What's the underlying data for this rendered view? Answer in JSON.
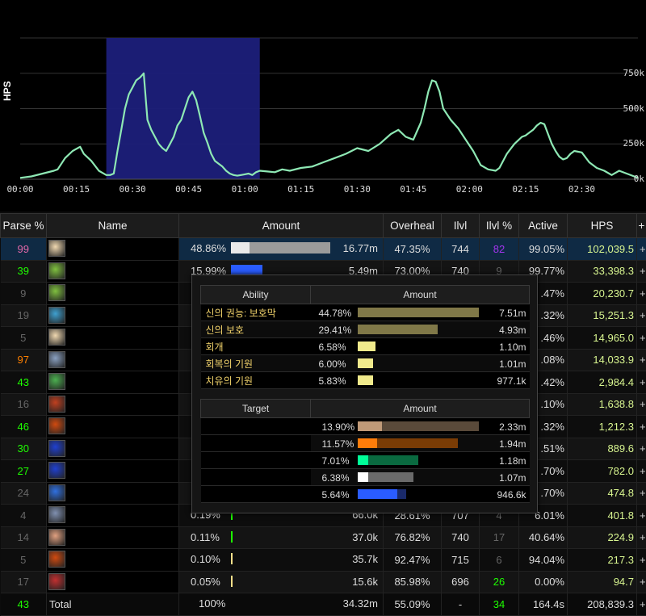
{
  "chart_data": {
    "type": "area",
    "ylabel": "HPS",
    "y_ticks": [
      "750k",
      "500k",
      "250k",
      "0k"
    ],
    "y_tick_values": [
      750000,
      500000,
      250000,
      0
    ],
    "x_ticks": [
      "00:00",
      "00:15",
      "00:30",
      "00:45",
      "01:00",
      "01:15",
      "01:30",
      "01:45",
      "02:00",
      "02:15",
      "02:30"
    ],
    "ylim": [
      0,
      1000000
    ],
    "xlim_seconds": [
      0,
      165
    ],
    "selection_seconds": [
      23,
      64
    ],
    "line_color": "#8ee8b4",
    "selection_color": "#1c1f7a",
    "series": [
      {
        "x": [
          0,
          3,
          6,
          9,
          10,
          12,
          14,
          16,
          17,
          19,
          21,
          23,
          24,
          25,
          26,
          27,
          28,
          29,
          30,
          31,
          32,
          33,
          34,
          35,
          36,
          37,
          38,
          39,
          40,
          41,
          42,
          43,
          44,
          45,
          46,
          47,
          48,
          49,
          50,
          51,
          52,
          53,
          54,
          55,
          56,
          57,
          58,
          59,
          60,
          61,
          62,
          63,
          64,
          66,
          68,
          70,
          72,
          75,
          78,
          81,
          84,
          87,
          90,
          93,
          96,
          99,
          101,
          103,
          105,
          107,
          108,
          109,
          110,
          111,
          112,
          113,
          115,
          117,
          119,
          121,
          123,
          125,
          127,
          128,
          130,
          132,
          134,
          135,
          136,
          137,
          138,
          139,
          140,
          141,
          142,
          143,
          144,
          145,
          146,
          147,
          148,
          150,
          152,
          154,
          156,
          158,
          160,
          162,
          164,
          165
        ],
        "y": [
          10000,
          20000,
          40000,
          60000,
          70000,
          150000,
          200000,
          230000,
          180000,
          130000,
          60000,
          30000,
          30000,
          40000,
          200000,
          350000,
          500000,
          600000,
          650000,
          700000,
          720000,
          750000,
          420000,
          350000,
          300000,
          250000,
          220000,
          200000,
          250000,
          300000,
          380000,
          420000,
          500000,
          580000,
          620000,
          560000,
          450000,
          330000,
          260000,
          180000,
          130000,
          110000,
          90000,
          60000,
          40000,
          30000,
          25000,
          30000,
          35000,
          40000,
          30000,
          50000,
          60000,
          55000,
          50000,
          70000,
          60000,
          80000,
          90000,
          120000,
          150000,
          180000,
          220000,
          200000,
          250000,
          320000,
          350000,
          300000,
          280000,
          400000,
          500000,
          620000,
          700000,
          690000,
          620000,
          500000,
          420000,
          360000,
          280000,
          200000,
          100000,
          70000,
          60000,
          80000,
          180000,
          250000,
          300000,
          310000,
          330000,
          350000,
          380000,
          400000,
          390000,
          320000,
          250000,
          200000,
          160000,
          140000,
          150000,
          180000,
          200000,
          190000,
          120000,
          80000,
          60000,
          30000,
          60000,
          40000,
          20000,
          10000
        ]
      }
    ]
  },
  "columns": [
    "Parse %",
    "Name",
    "Amount",
    "Overheal",
    "Ilvl",
    "Ilvl %",
    "Active",
    "HPS",
    "+"
  ],
  "players": [
    {
      "parse": "99",
      "parse_color": "#e268a8",
      "amount_pct": "48.86%",
      "amount": "16.77m",
      "bar1": 0.184,
      "bar1_color": "#e9e9e9",
      "bar2": 0.816,
      "bar2_color": "#9b9b9b",
      "overheal": "47.35%",
      "ilvl": "744",
      "ilvl_pct": "82",
      "ilvl_pct_color": "#a335ee",
      "active": "99.05%",
      "hps": "102,039.5",
      "icon": "holy-priest-icon",
      "icon_color": "#f0d8b0"
    },
    {
      "parse": "39",
      "parse_color": "#1eff00",
      "amount_pct": "15.99%",
      "amount": "5.49m",
      "bar1": 0.32,
      "bar1_color": "#2a5cff",
      "bar2": 0,
      "bar2_color": "#1a2a6a",
      "overheal": "73.00%",
      "ilvl": "740",
      "ilvl_pct": "9",
      "ilvl_pct_color": "#666666",
      "active": "99.77%",
      "hps": "33,398.3",
      "icon": "resto-druid-icon",
      "icon_color": "#7fbf3f"
    },
    {
      "parse": "9",
      "parse_color": "#666666",
      "amount_pct": "",
      "amount": "",
      "bar1": 0,
      "bar1_color": "#ffffff",
      "bar2": 0,
      "bar2_color": "#000000",
      "overheal": "",
      "ilvl": "",
      "ilvl_pct": "",
      "ilvl_pct_color": "#666666",
      "active": ".47%",
      "hps": "20,230.7",
      "icon": "resto-druid-icon",
      "icon_color": "#7fbf3f"
    },
    {
      "parse": "19",
      "parse_color": "#666666",
      "amount_pct": "",
      "amount": "",
      "bar1": 0,
      "bar1_color": "#ffffff",
      "bar2": 0,
      "bar2_color": "#000000",
      "overheal": "",
      "ilvl": "",
      "ilvl_pct": "",
      "ilvl_pct_color": "#666666",
      "active": ".32%",
      "hps": "15,251.3",
      "icon": "mistweaver-icon",
      "icon_color": "#3fa0d0"
    },
    {
      "parse": "5",
      "parse_color": "#666666",
      "amount_pct": "",
      "amount": "",
      "bar1": 0,
      "bar1_color": "#ffffff",
      "bar2": 0,
      "bar2_color": "#000000",
      "overheal": "",
      "ilvl": "",
      "ilvl_pct": "",
      "ilvl_pct_color": "#666666",
      "active": ".46%",
      "hps": "14,965.0",
      "icon": "holy-priest-icon",
      "icon_color": "#f0d8b0"
    },
    {
      "parse": "97",
      "parse_color": "#ff8000",
      "amount_pct": "",
      "amount": "",
      "bar1": 0,
      "bar1_color": "#ffffff",
      "bar2": 0,
      "bar2_color": "#000000",
      "overheal": "",
      "ilvl": "",
      "ilvl_pct": "",
      "ilvl_pct_color": "#666666",
      "active": ".08%",
      "hps": "14,033.9",
      "icon": "protection-warrior-icon",
      "icon_color": "#8aa0c0"
    },
    {
      "parse": "43",
      "parse_color": "#1eff00",
      "amount_pct": "",
      "amount": "",
      "bar1": 0,
      "bar1_color": "#ffffff",
      "bar2": 0,
      "bar2_color": "#000000",
      "overheal": "",
      "ilvl": "",
      "ilvl_pct": "",
      "ilvl_pct_color": "#666666",
      "active": ".42%",
      "hps": "2,984.4",
      "icon": "guardian-druid-icon",
      "icon_color": "#4caf50"
    },
    {
      "parse": "16",
      "parse_color": "#666666",
      "amount_pct": "",
      "amount": "",
      "bar1": 0,
      "bar1_color": "#ffffff",
      "bar2": 0,
      "bar2_color": "#000000",
      "overheal": "",
      "ilvl": "",
      "ilvl_pct": "",
      "ilvl_pct_color": "#666666",
      "active": ".10%",
      "hps": "1,638.8",
      "icon": "fury-warrior-icon",
      "icon_color": "#c04020"
    },
    {
      "parse": "46",
      "parse_color": "#1eff00",
      "amount_pct": "",
      "amount": "",
      "bar1": 0,
      "bar1_color": "#ffffff",
      "bar2": 0,
      "bar2_color": "#000000",
      "overheal": "",
      "ilvl": "",
      "ilvl_pct": "",
      "ilvl_pct_color": "#666666",
      "active": ".32%",
      "hps": "1,212.3",
      "icon": "retribution-paladin-icon",
      "icon_color": "#d04a10"
    },
    {
      "parse": "30",
      "parse_color": "#1eff00",
      "amount_pct": "",
      "amount": "",
      "bar1": 0,
      "bar1_color": "#ffffff",
      "bar2": 0,
      "bar2_color": "#000000",
      "overheal": "",
      "ilvl": "",
      "ilvl_pct": "",
      "ilvl_pct_color": "#666666",
      "active": ".51%",
      "hps": "889.6",
      "icon": "elemental-shaman-icon",
      "icon_color": "#2040d0"
    },
    {
      "parse": "27",
      "parse_color": "#1eff00",
      "amount_pct": "",
      "amount": "",
      "bar1": 0,
      "bar1_color": "#ffffff",
      "bar2": 0,
      "bar2_color": "#000000",
      "overheal": "",
      "ilvl": "",
      "ilvl_pct": "",
      "ilvl_pct_color": "#666666",
      "active": ".70%",
      "hps": "782.0",
      "icon": "elemental-shaman-icon",
      "icon_color": "#2040d0"
    },
    {
      "parse": "24",
      "parse_color": "#666666",
      "amount_pct": "",
      "amount": "",
      "bar1": 0,
      "bar1_color": "#ffffff",
      "bar2": 0,
      "bar2_color": "#000000",
      "overheal": "",
      "ilvl": "",
      "ilvl_pct": "",
      "ilvl_pct_color": "#666666",
      "active": ".70%",
      "hps": "474.8",
      "icon": "frost-mage-icon",
      "icon_color": "#3070e0"
    },
    {
      "parse": "4",
      "parse_color": "#666666",
      "amount_pct": "0.19%",
      "amount": "66.0k",
      "bar1": 0.012,
      "bar1_color": "#1eff00",
      "bar2": 0,
      "bar2_color": "#000000",
      "overheal": "28.61%",
      "ilvl": "707",
      "ilvl_pct": "4",
      "ilvl_pct_color": "#666666",
      "active": "6.01%",
      "hps": "401.8",
      "icon": "death-knight-icon",
      "icon_color": "#8090b0"
    },
    {
      "parse": "14",
      "parse_color": "#666666",
      "amount_pct": "0.11%",
      "amount": "37.0k",
      "bar1": 0.008,
      "bar1_color": "#1eff00",
      "bar2": 0,
      "bar2_color": "#000000",
      "overheal": "76.82%",
      "ilvl": "740",
      "ilvl_pct": "17",
      "ilvl_pct_color": "#666666",
      "active": "40.64%",
      "hps": "224.9",
      "icon": "holy-paladin-icon",
      "icon_color": "#e0a080"
    },
    {
      "parse": "5",
      "parse_color": "#666666",
      "amount_pct": "0.10%",
      "amount": "35.7k",
      "bar1": 0.008,
      "bar1_color": "#ffe08a",
      "bar2": 0,
      "bar2_color": "#000000",
      "overheal": "92.47%",
      "ilvl": "715",
      "ilvl_pct": "6",
      "ilvl_pct_color": "#666666",
      "active": "94.04%",
      "hps": "217.3",
      "icon": "retribution-paladin-icon",
      "icon_color": "#d04a10"
    },
    {
      "parse": "17",
      "parse_color": "#666666",
      "amount_pct": "0.05%",
      "amount": "15.6k",
      "bar1": 0.006,
      "bar1_color": "#ffe08a",
      "bar2": 0,
      "bar2_color": "#000000",
      "overheal": "85.98%",
      "ilvl": "696",
      "ilvl_pct": "26",
      "ilvl_pct_color": "#1eff00",
      "active": "0.00%",
      "hps": "94.7",
      "icon": "arms-warrior-icon",
      "icon_color": "#c03030"
    }
  ],
  "total": {
    "parse": "43",
    "parse_color": "#1eff00",
    "name": "Total",
    "amount_pct": "100%",
    "amount": "34.32m",
    "overheal": "55.09%",
    "ilvl": "-",
    "ilvl_pct": "34",
    "ilvl_pct_color": "#1eff00",
    "active": "164.4s",
    "hps": "208,839.3"
  },
  "tooltip": {
    "ability_header": "Ability",
    "amount_header": "Amount",
    "target_header": "Target",
    "abilities": [
      {
        "name": "신의 권능: 보호막",
        "pct": "44.78%",
        "amount": "7.51m",
        "fill": 1.0,
        "color": "#807848"
      },
      {
        "name": "신의 보호",
        "pct": "29.41%",
        "amount": "4.93m",
        "fill": 0.66,
        "color": "#807848"
      },
      {
        "name": "회개",
        "pct": "6.58%",
        "amount": "1.10m",
        "fill": 0.15,
        "color": "#f0ea8c"
      },
      {
        "name": "회복의 기원",
        "pct": "6.00%",
        "amount": "1.01m",
        "fill": 0.13,
        "color": "#f0ea8c"
      },
      {
        "name": "치유의 기원",
        "pct": "5.83%",
        "amount": "977.1k",
        "fill": 0.13,
        "color": "#f0ea8c"
      }
    ],
    "targets": [
      {
        "pct": "13.90%",
        "amount": "2.33m",
        "fill1": 0.2,
        "color1": "#c09a78",
        "fill2": 0.8,
        "color2": "#5a4a3a"
      },
      {
        "pct": "11.57%",
        "amount": "1.94m",
        "fill1": 0.16,
        "color1": "#ff7d0a",
        "fill2": 0.67,
        "color2": "#7a3c05"
      },
      {
        "pct": "7.01%",
        "amount": "1.18m",
        "fill1": 0.09,
        "color1": "#00ff98",
        "fill2": 0.41,
        "color2": "#0a6a40"
      },
      {
        "pct": "6.38%",
        "amount": "1.07m",
        "fill1": 0.09,
        "color1": "#ffffff",
        "fill2": 0.37,
        "color2": "#6a6a6a"
      },
      {
        "pct": "5.64%",
        "amount": "946.6k",
        "fill1": 0.33,
        "color1": "#2a5cff",
        "fill2": 0.07,
        "color2": "#1a2a6a"
      }
    ]
  }
}
